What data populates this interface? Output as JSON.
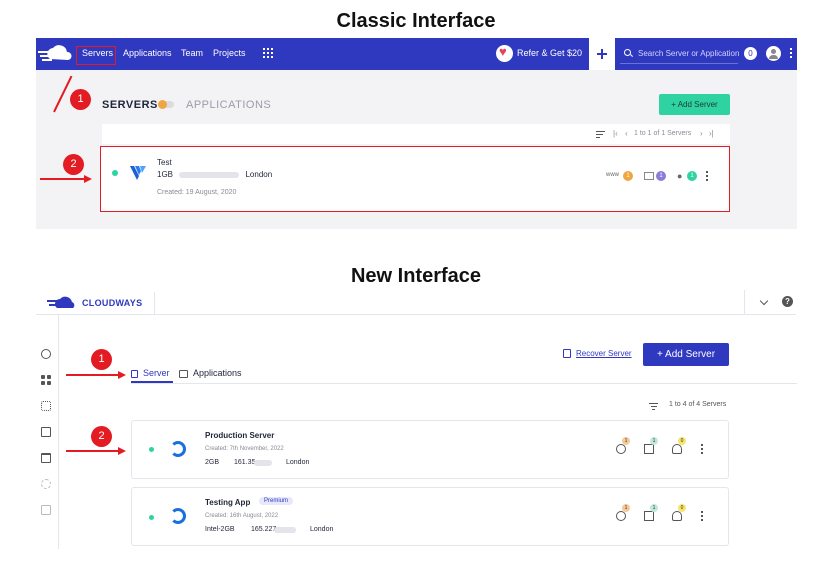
{
  "headings": {
    "classic": "Classic Interface",
    "new": "New Interface"
  },
  "classic": {
    "nav": {
      "servers": "Servers",
      "applications": "Applications",
      "team": "Team",
      "projects": "Projects"
    },
    "refer_label": "Refer & Get $20",
    "search_placeholder": "Search Server or Application",
    "notification_count": "0",
    "tabs": {
      "servers": "SERVERS",
      "applications": "APPLICATIONS"
    },
    "add_server_label": "+ Add Server",
    "pager_text": "1 to 1 of 1 Servers",
    "server": {
      "name": "Test",
      "size": "1GB",
      "location": "London",
      "created": "Created: 19 August, 2020",
      "www_label": "www",
      "counts": {
        "apps": "1",
        "files": "1",
        "users": "1"
      }
    },
    "annotations": [
      "1",
      "2"
    ]
  },
  "new": {
    "brand": "CLOUDWAYS",
    "help_label": "?",
    "recover_label": "Recover Server",
    "add_server_label": "+ Add Server",
    "tabs": {
      "server": "Server",
      "applications": "Applications"
    },
    "pager_text": "1 to 4 of 4 Servers",
    "servers": [
      {
        "name": "Production Server",
        "badge": "",
        "created": "Created: 7th November, 2022",
        "size": "2GB",
        "ip": "161.35.",
        "location": "London",
        "counts": {
          "web": "1",
          "files": "1",
          "users": "0"
        }
      },
      {
        "name": "Testing App",
        "badge": "Premium",
        "created": "Created: 16th August, 2022",
        "size": "Intel-2GB",
        "ip": "165.227.",
        "location": "London",
        "counts": {
          "web": "1",
          "files": "1",
          "users": "0"
        }
      }
    ],
    "annotations": [
      "1",
      "2"
    ]
  },
  "colors": {
    "brand_blue": "#2f39bf",
    "accent_green": "#2ed3a1",
    "annotation_red": "#e31b23"
  }
}
